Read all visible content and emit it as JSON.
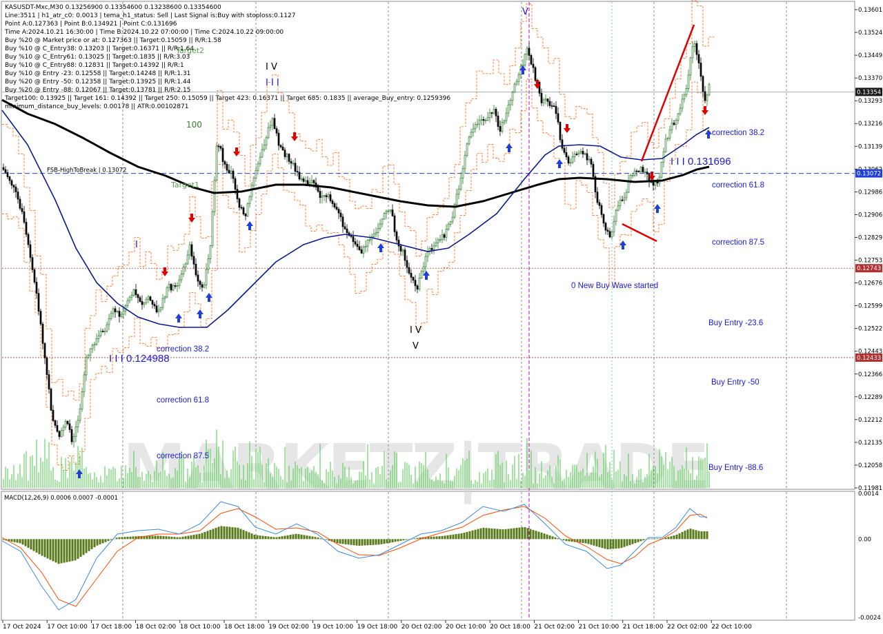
{
  "header": {
    "lines": [
      "KASUSDT-Mxc,M30  0.13256900 0.13354600 0.13238600 0.13354600",
      "Line:3511  |  h1_atr_c0: 0.0013  |  tema_h1_status: Sell  |  Last Signal is:Buy with stoploss:0.1127",
      "Point A:0.127363  |  Point B:0.134921  |  Point C:0.131696",
      "Time A:2024.10.21 16:30:00  |  Time B:2024.10.22 07:00:00  |  Time C:2024.10.22 09:00:00",
      "Buy %20 @ Market price or at: 0.127363  ||  Target:0.15059  ||  R/R:1.58",
      "Buy %10 @ C_Entry38: 0.13203  ||  Target:0.16371  ||  R/R:1.64",
      "Buy %10 @ C_Entry61: 0.13025  ||  Target:0.1835  ||  R/R:3.03",
      "Buy %10 @ C_Entry88: 0.12831  ||  Target:0.14392  ||  R/R:1",
      "Buy %10 @ Entry -23: 0.12558  ||  Target:0.14248  ||  R/R:1.31",
      "Buy %20 @ Entry -50: 0.12358  ||  Target:0.13925  ||  R/R:1.44",
      "Buy %20 @ Entry -88: 0.12067  ||  Target:0.13781  ||  R/R:2.15",
      "Target100: 0.13925  ||  Target 161: 0.14392  ||  Target 250: 0.15059  ||  Target 423: 0.16371  ||  Target 685: 0.1835  ||  average_Buy_entry: 0.1259396",
      "minimum_distance_buy_levels: 0.00178  ||  ATR:0.00102871"
    ]
  },
  "watermark": "MARKETZ|TRADE",
  "chart_data": [
    {
      "type": "candlestick",
      "symbol": "KASUSDT-Mxc",
      "timeframe": "M30",
      "ohlc_last": {
        "open": 0.132569,
        "high": 0.133546,
        "low": 0.132386,
        "close": 0.133546
      },
      "y_ticks": [
        "0.13601",
        "0.13524",
        "0.13449",
        "0.13370",
        "0.13293",
        "0.13216",
        "0.13139",
        "0.13062",
        "0.12986",
        "0.12906",
        "0.12829",
        "0.12753",
        "0.12676",
        "0.12599",
        "0.12522",
        "0.12443",
        "0.12366",
        "0.12289",
        "0.12212",
        "0.12135",
        "0.12058",
        "0.11981"
      ],
      "ylim": [
        0.11981,
        0.1364
      ],
      "x_labels": [
        "17 Oct 2024",
        "17 Oct 10:00",
        "17 Oct 18:00",
        "18 Oct 02:00",
        "18 Oct 10:00",
        "18 Oct 18:00",
        "19 Oct 02:00",
        "19 Oct 10:00",
        "19 Oct 18:00",
        "20 Oct 02:00",
        "20 Oct 10:00",
        "20 Oct 18:00",
        "21 Oct 02:00",
        "21 Oct 10:00",
        "21 Oct 18:00",
        "22 Oct 02:00",
        "22 Oct 10:00"
      ],
      "price_tags": [
        {
          "value": "0.13354",
          "bg": "#1a1a1a"
        },
        {
          "value": "0.13072",
          "bg": "#1f3fd6"
        },
        {
          "value": "0.12743",
          "bg": "#b03030"
        },
        {
          "value": "0.12433",
          "bg": "#b03030"
        }
      ],
      "levels": [
        {
          "label": "FSB-HighToBreak | 0.13072",
          "value": 0.13072
        },
        {
          "label": "",
          "value": 0.12743
        },
        {
          "label": "",
          "value": 0.12433
        }
      ],
      "annotations": [
        {
          "text": "correction 38.2"
        },
        {
          "text": "correction 61.8"
        },
        {
          "text": "correction 87.5"
        },
        {
          "text": "0 New Buy Wave started"
        },
        {
          "text": "Buy Entry -23.6"
        },
        {
          "text": "Buy Entry -50"
        },
        {
          "text": "Buy Entry -88.6"
        },
        {
          "text": "I I I 0.131696"
        },
        {
          "text": "correction 38.2"
        },
        {
          "text": "I I I 0.124988"
        },
        {
          "text": "correction 61.8"
        },
        {
          "text": "correction 87.5"
        },
        {
          "text": "100"
        },
        {
          "text": "Target1"
        },
        {
          "text": "Target2"
        },
        {
          "text": "I V"
        },
        {
          "text": "I I I"
        },
        {
          "text": "I V"
        },
        {
          "text": "V"
        },
        {
          "text": "V"
        },
        {
          "text": "I"
        }
      ],
      "colors": {
        "ema_fast": "#0a1a8c",
        "ema_slow": "#000000",
        "envelope": "#ff5a00",
        "bull": "#2a7a2a",
        "bear": "#000000",
        "volume": "#44cc44",
        "arrow_up": "#1f3fd6",
        "arrow_down": "#e00000"
      }
    },
    {
      "type": "macd",
      "title": "MACD(12,26,9) 0.0006 0.0007 -0.0001",
      "params": [
        12,
        26,
        9
      ],
      "values": {
        "macd": 0.0006,
        "signal": 0.0007,
        "hist": -0.0001
      },
      "y_ticks": [
        "0.0014",
        "0.00",
        "-0.0024"
      ],
      "ylim": [
        -0.0024,
        0.0014
      ]
    }
  ]
}
